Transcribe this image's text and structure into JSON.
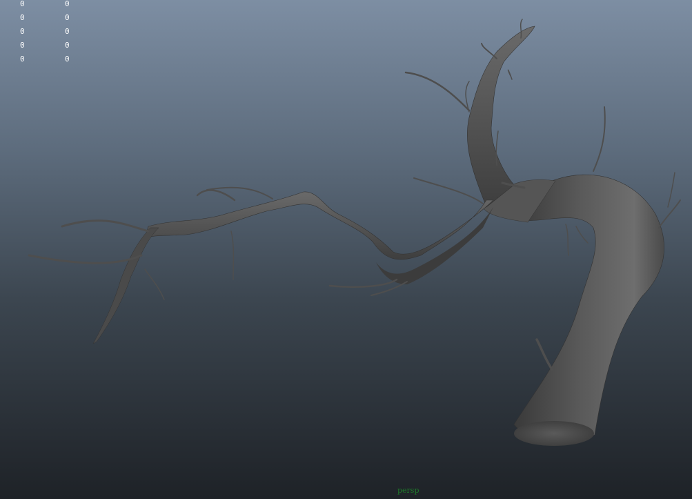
{
  "viewport": {
    "camera": "persp",
    "hud_rows": [
      {
        "a": "0",
        "b": "0"
      },
      {
        "a": "0",
        "b": "0"
      },
      {
        "a": "0",
        "b": "0"
      },
      {
        "a": "0",
        "b": "0"
      },
      {
        "a": "0",
        "b": "0"
      }
    ],
    "label_color": "#1e7a2a",
    "hud_color": "#ffffff",
    "model": "tree-branch-mesh"
  }
}
